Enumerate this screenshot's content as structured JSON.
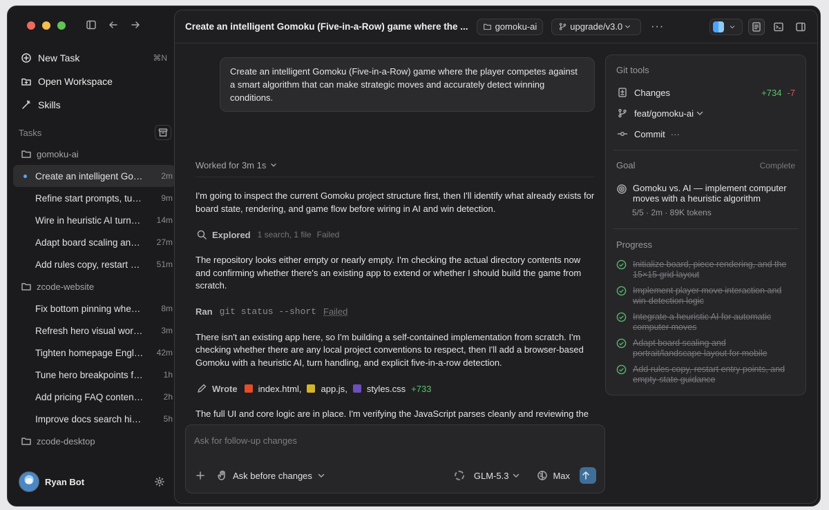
{
  "sidebar": {
    "nav": [
      {
        "label": "New Task",
        "shortcut": "⌘N"
      },
      {
        "label": "Open Workspace"
      },
      {
        "label": "Skills"
      }
    ],
    "tasks_label": "Tasks",
    "groups": [
      {
        "name": "gomoku-ai",
        "tasks": [
          {
            "title": "Create an intelligent Gomoku (Five-in-a-Row) game where the player competes against a smart algorithm",
            "time": "2m",
            "active": true
          },
          {
            "title": "Refine start prompts, turn messaging",
            "time": "9m"
          },
          {
            "title": "Wire in heuristic AI turns and scoring",
            "time": "14m"
          },
          {
            "title": "Adapt board scaling and layout",
            "time": "27m"
          },
          {
            "title": "Add rules copy, restart entry points",
            "time": "51m"
          }
        ]
      },
      {
        "name": "zcode-website",
        "tasks": [
          {
            "title": "Fix bottom pinning when scrolling",
            "time": "8m"
          },
          {
            "title": "Refresh hero visual workflow",
            "time": "3m"
          },
          {
            "title": "Tighten homepage English copy",
            "time": "42m"
          },
          {
            "title": "Tune hero breakpoints for mobile",
            "time": "1h"
          },
          {
            "title": "Add pricing FAQ content and layout",
            "time": "2h"
          },
          {
            "title": "Improve docs search highlighting",
            "time": "5h"
          }
        ]
      },
      {
        "name": "zcode-desktop",
        "tasks": []
      }
    ],
    "user": {
      "name": "Ryan Bot"
    }
  },
  "topbar": {
    "title": "Create an intelligent Gomoku (Five-in-a-Row) game where the ...",
    "folder": "gomoku-ai",
    "branch": "upgrade/v3.0"
  },
  "chat": {
    "prompt": "Create an intelligent Gomoku (Five-in-a-Row) game where the player competes against a smart algorithm that can make strategic moves and accurately detect winning conditions.",
    "worked": "Worked for 3m 1s",
    "p1": "I'm going to inspect the current Gomoku project structure first, then I'll identify what already exists for board state, rendering, and game flow before wiring in AI and win detection.",
    "explored": {
      "label": "Explored",
      "meta": "1 search, 1 file",
      "status": "Failed"
    },
    "p2": "The repository looks either empty or nearly empty. I'm checking the actual directory contents now and confirming whether there's an existing app to extend or whether I should build the game from scratch.",
    "ran": {
      "label": "Ran",
      "command": "git status --short",
      "status": "Failed"
    },
    "p3": "There isn't an existing app here, so I'm building a self-contained implementation from scratch. I'm checking whether there are any local project conventions to respect, then I'll add a browser-based Gomoku with a heuristic AI, turn handling, and explicit five-in-a-row detection.",
    "wrote": {
      "label": "Wrote",
      "files": [
        "index.html",
        "app.js",
        "styles.css"
      ],
      "diff": "+733"
    },
    "p4": "The full UI and core logic are in place. I'm verifying the JavaScript parses cleanly and reviewing the move-scoring logic for edge cases like first-move response, draw handling, and long-line wins."
  },
  "git": {
    "title": "Git tools",
    "changes_label": "Changes",
    "additions": "+734",
    "deletions": "-7",
    "branch": "feat/gomoku-ai",
    "commit_label": "Commit",
    "goal_label": "Goal",
    "goal_status": "Complete",
    "goal_text": "Gomoku vs. AI — implement computer moves with a heuristic algorithm",
    "goal_meta": "5/5 · 2m · 89K tokens",
    "progress_label": "Progress",
    "progress": [
      "Initialize board, piece rendering, and the 15×15 grid layout",
      "Implement player move interaction and win-detection logic",
      "Integrate a heuristic AI for automatic computer moves",
      "Adapt board scaling and portrait/landscape layout for mobile",
      "Add rules copy, restart entry points, and empty-state guidance"
    ]
  },
  "composer": {
    "placeholder": "Ask for follow-up changes",
    "mode": "Ask before changes",
    "model": "GLM-5.3",
    "effort": "Max"
  },
  "colors": {
    "accent": "#5ba7f0",
    "added": "#5cc26a",
    "removed": "#e5534b"
  }
}
